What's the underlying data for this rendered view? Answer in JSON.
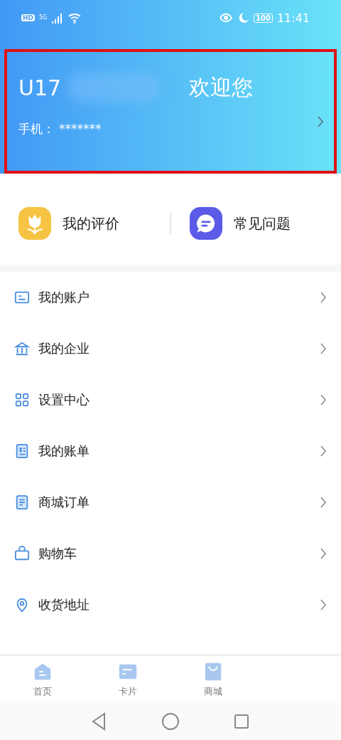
{
  "status_bar": {
    "network_badge": "HD",
    "network_type": "5G",
    "battery": "100",
    "time": "11:41"
  },
  "profile": {
    "username": "U17",
    "greeting": "欢迎您",
    "phone_label": "手机：",
    "phone": "*******",
    "highlighted": true
  },
  "shortcuts": [
    {
      "label": "我的评价",
      "kind": "review"
    },
    {
      "label": "常见问题",
      "kind": "faq"
    }
  ],
  "menu": [
    {
      "label": "我的账户",
      "kind": "account"
    },
    {
      "label": "我的企业",
      "kind": "company"
    },
    {
      "label": "设置中心",
      "kind": "settings"
    },
    {
      "label": "我的账单",
      "kind": "bill"
    },
    {
      "label": "商城订单",
      "kind": "order"
    },
    {
      "label": "购物车",
      "kind": "cart"
    },
    {
      "label": "收货地址",
      "kind": "address"
    }
  ],
  "tab_bar": [
    {
      "label": "首页",
      "kind": "home",
      "selected": false
    },
    {
      "label": "卡片",
      "kind": "card",
      "selected": false
    },
    {
      "label": "商城",
      "kind": "mall",
      "selected": false
    }
  ]
}
